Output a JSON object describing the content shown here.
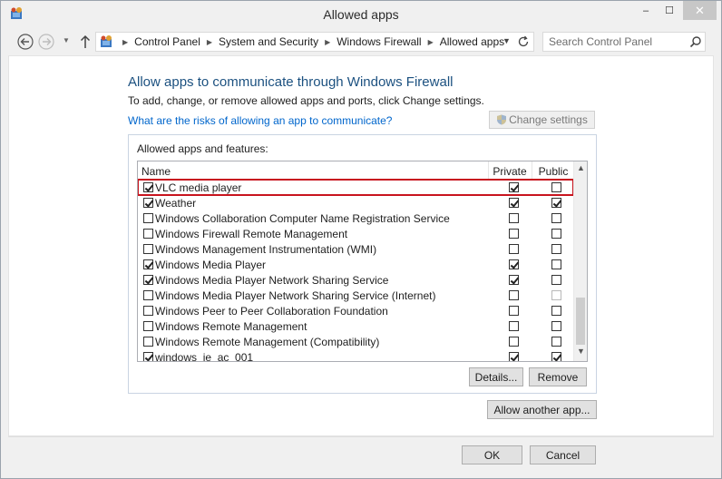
{
  "window": {
    "title": "Allowed apps",
    "minimize_glyph": "–",
    "maximize_glyph": "☐",
    "close_glyph": "✕"
  },
  "address": {
    "breadcrumbs": [
      "Control Panel",
      "System and Security",
      "Windows Firewall",
      "Allowed apps"
    ],
    "search_placeholder": "Search Control Panel"
  },
  "main": {
    "heading": "Allow apps to communicate through Windows Firewall",
    "subtext": "To add, change, or remove allowed apps and ports, click Change settings.",
    "risk_link": "What are the risks of allowing an app to communicate?",
    "change_settings_label": "Change settings",
    "group_label": "Allowed apps and features:",
    "columns": {
      "name": "Name",
      "private": "Private",
      "public": "Public"
    },
    "apps": [
      {
        "name": "VLC media player",
        "enabled": true,
        "private": true,
        "public": false,
        "selected": true
      },
      {
        "name": "Weather",
        "enabled": true,
        "private": true,
        "public": true
      },
      {
        "name": "Windows Collaboration Computer Name Registration Service",
        "enabled": false,
        "private": false,
        "public": false
      },
      {
        "name": "Windows Firewall Remote Management",
        "enabled": false,
        "private": false,
        "public": false
      },
      {
        "name": "Windows Management Instrumentation (WMI)",
        "enabled": false,
        "private": false,
        "public": false
      },
      {
        "name": "Windows Media Player",
        "enabled": true,
        "private": true,
        "public": false
      },
      {
        "name": "Windows Media Player Network Sharing Service",
        "enabled": true,
        "private": true,
        "public": false
      },
      {
        "name": "Windows Media Player Network Sharing Service (Internet)",
        "enabled": false,
        "private": false,
        "public": false,
        "public_disabled": true
      },
      {
        "name": "Windows Peer to Peer Collaboration Foundation",
        "enabled": false,
        "private": false,
        "public": false
      },
      {
        "name": "Windows Remote Management",
        "enabled": false,
        "private": false,
        "public": false
      },
      {
        "name": "Windows Remote Management (Compatibility)",
        "enabled": false,
        "private": false,
        "public": false
      },
      {
        "name": "windows_ie_ac_001",
        "enabled": true,
        "private": true,
        "public": true
      }
    ],
    "details_label": "Details...",
    "remove_label": "Remove",
    "allow_another_label": "Allow another app..."
  },
  "footer": {
    "ok_label": "OK",
    "cancel_label": "Cancel"
  },
  "colors": {
    "heading": "#1c5180",
    "link": "#0066cc",
    "selection_outline": "#c8141e"
  }
}
